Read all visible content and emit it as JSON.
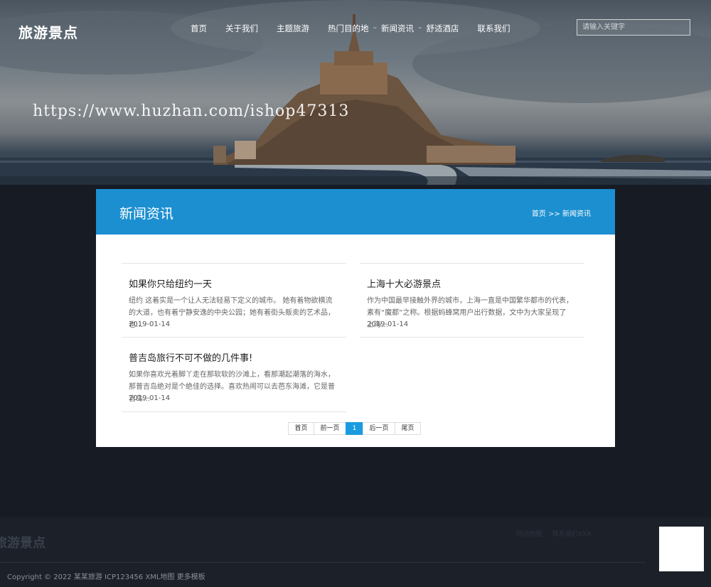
{
  "header": {
    "logo": "旅游景点",
    "nav": [
      "首页",
      "关于我们",
      "主题旅游",
      "热门目的地",
      "新闻资讯",
      "舒适酒店",
      "联系我们"
    ],
    "search_placeholder": "请输入关键字",
    "watermark": "https://www.huzhan.com/ishop47313"
  },
  "panel": {
    "title": "新闻资讯",
    "breadcrumb": {
      "home": "首页",
      "separator": ">>",
      "current": "新闻资讯"
    }
  },
  "articles": [
    {
      "title": "如果你只给纽约一天",
      "desc": "纽约 这着实是一个让人无法轻易下定义的城市。 她有着物欲横流的大道，也有着宁静安逸的中央公园；她有着街头贩卖的艺术品，也…",
      "date": "2019-01-14"
    },
    {
      "title": "上海十大必游景点",
      "desc": "作为中国最早接触外界的城市，上海一直是中国繁华都市的代表，素有“魔都”之称。根据蚂蜂窝用户出行数据，文中为大家呈现了上海…",
      "date": "2019-01-14"
    },
    {
      "title": "普吉岛旅行不可不做的几件事!",
      "desc": "如果你喜欢光着脚丫走在那软软的沙滩上，看那潮起潮落的海水，那普吉岛绝对是个绝佳的选择。喜欢热闹可以去芭东海滩，它是普吉岛…",
      "date": "2019-01-14"
    }
  ],
  "pagination": {
    "first": "首页",
    "prev": "前一页",
    "current": "1",
    "next": "后一页",
    "last": "尾页"
  },
  "footer": {
    "logo": "旅游景点",
    "links": [
      "网站地图",
      "联系我们XXX"
    ],
    "copyright": "Copyright © 2022 某某旅游 ICP123456 XML地图 更多模板"
  }
}
